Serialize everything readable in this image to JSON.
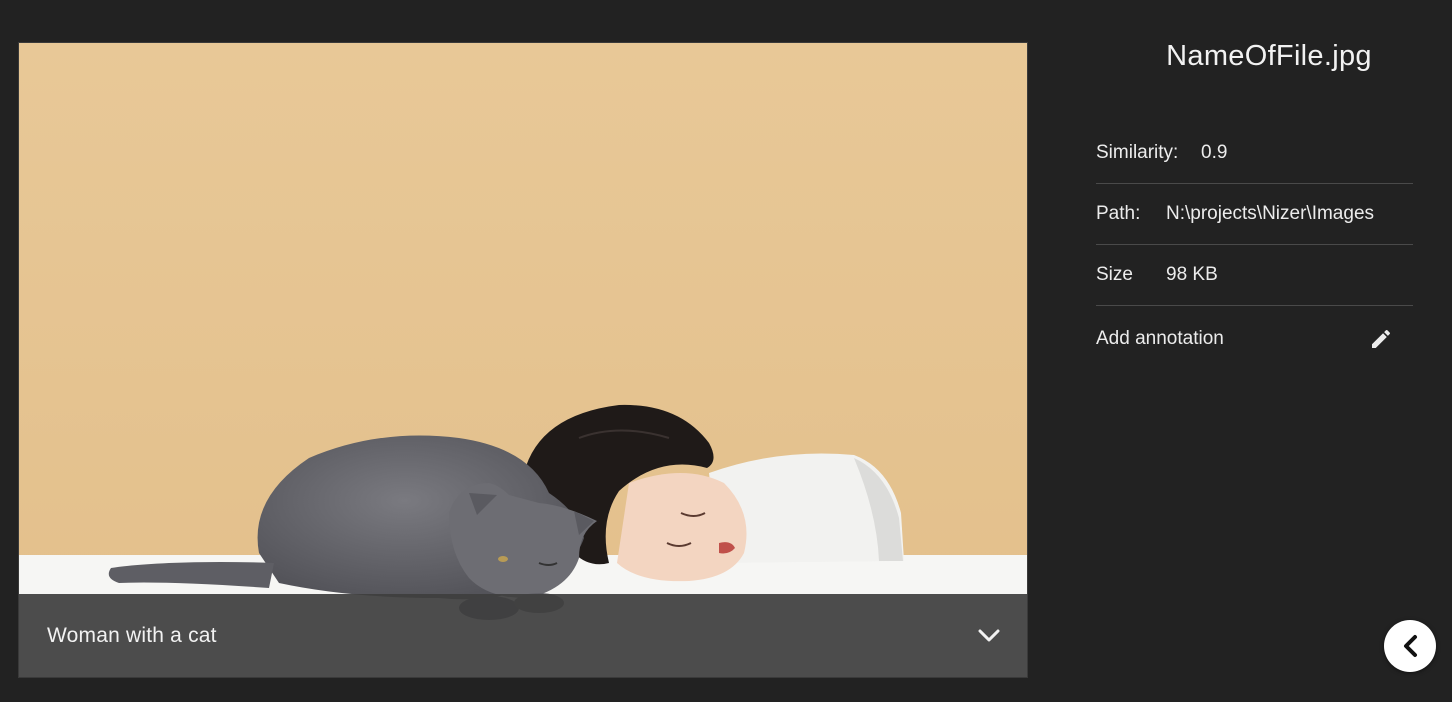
{
  "image": {
    "caption": "Woman with a cat",
    "expand_icon": "chevron-down-icon"
  },
  "details": {
    "file_name": "NameOfFile.jpg",
    "similarity": {
      "label": "Similarity:",
      "value": "0.9"
    },
    "path": {
      "label": "Path:",
      "value": "N:\\projects\\Nizer\\Images"
    },
    "size": {
      "label": "Size",
      "value": "98 KB"
    },
    "annotation": {
      "label": "Add annotation",
      "icon": "pencil-icon"
    }
  },
  "collapse": {
    "icon": "chevron-left-icon",
    "glyph": "❮"
  },
  "colors": {
    "background": "#222222",
    "caption_bar": "#3e3e3e",
    "photo_backdrop": "#e6c593",
    "text": "#f2f2f2",
    "divider": "#4a4a4a"
  }
}
